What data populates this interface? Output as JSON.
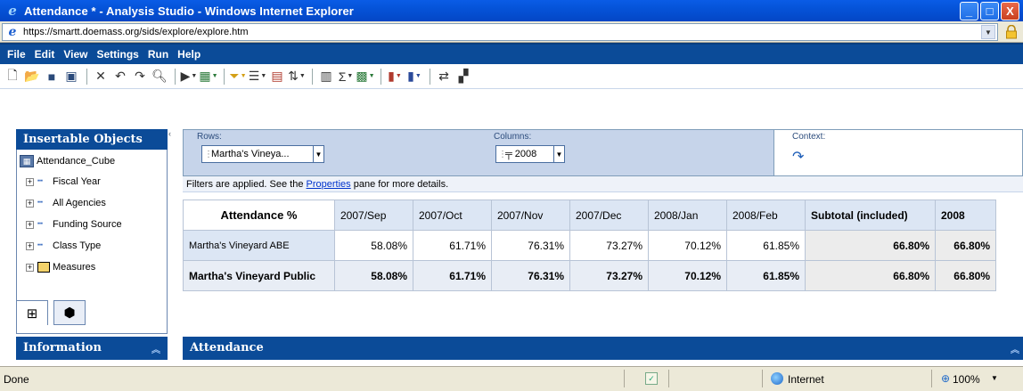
{
  "window": {
    "title": "Attendance * - Analysis Studio - Windows Internet Explorer",
    "controls": {
      "minimize": "_",
      "maximize": "□",
      "close": "X"
    }
  },
  "address": {
    "url": "https://smartt.doemass.org/sids/explore/explore.htm"
  },
  "menu": [
    "File",
    "Edit",
    "View",
    "Settings",
    "Run",
    "Help"
  ],
  "toolbar": {
    "icons": [
      "new-icon",
      "open-icon",
      "save-icon",
      "save-as-icon",
      "cut-icon",
      "undo-icon",
      "redo-icon",
      "find-icon",
      "run-icon",
      "insert-icon",
      "filter-icon",
      "suppress-icon",
      "calculate-icon",
      "sort-icon",
      "chart-icon",
      "sum-icon",
      "table-icon",
      "bar-chart-icon",
      "column-chart-icon",
      "swap-icon",
      "layout-icon"
    ]
  },
  "left_panel": {
    "title": "Insertable Objects",
    "cube": "Attendance_Cube",
    "items": [
      {
        "label": "Fiscal Year",
        "type": "dimension"
      },
      {
        "label": "All Agencies",
        "type": "dimension"
      },
      {
        "label": "Funding Source",
        "type": "dimension"
      },
      {
        "label": "Class Type",
        "type": "dimension"
      },
      {
        "label": "Measures",
        "type": "measures"
      }
    ],
    "information_title": "Information"
  },
  "drop_zones": {
    "rows_label": "Rows:",
    "rows_value": "Martha's Vineya...",
    "columns_label": "Columns:",
    "columns_value": "2008",
    "context_label": "Context:"
  },
  "filter_line": {
    "before": "Filters are applied. See the ",
    "link": "Properties",
    "after": " pane for more details."
  },
  "crosstab": {
    "corner": "Attendance %",
    "columns": [
      "2007/Sep",
      "2007/Oct",
      "2007/Nov",
      "2007/Dec",
      "2008/Jan",
      "2008/Feb"
    ],
    "subtotal_label": "Subtotal (included)",
    "total_label": "2008",
    "rows": [
      {
        "label": "Martha's Vineyard ABE",
        "values": [
          "58.08%",
          "61.71%",
          "76.31%",
          "73.27%",
          "70.12%",
          "61.85%"
        ],
        "subtotal": "66.80%",
        "total": "66.80%",
        "bold": false
      },
      {
        "label": "Martha's Vineyard Public",
        "values": [
          "58.08%",
          "61.71%",
          "76.31%",
          "73.27%",
          "70.12%",
          "61.85%"
        ],
        "subtotal": "66.80%",
        "total": "66.80%",
        "bold": true
      }
    ]
  },
  "section": {
    "title": "Attendance"
  },
  "status": {
    "text": "Done",
    "zone": "Internet",
    "zoom": "100%"
  },
  "colors": {
    "title_bar": "#0553d8",
    "menu_bar": "#0b4b98",
    "header_cell": "#dce6f4"
  }
}
